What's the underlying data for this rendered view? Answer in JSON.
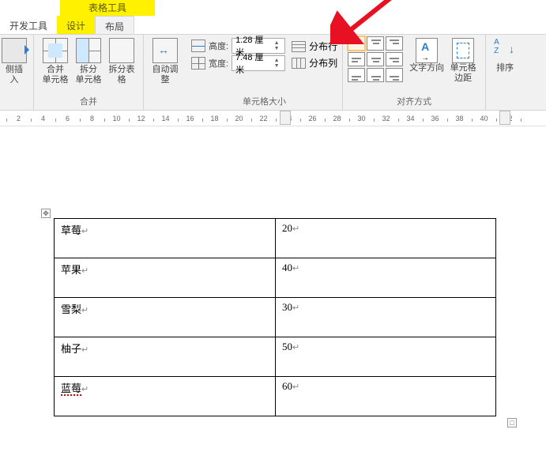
{
  "context_tab_title": "表格工具",
  "tabs": {
    "dev": "开发工具",
    "design": "设计",
    "layout": "布局"
  },
  "ribbon": {
    "insert_side": "侧插入",
    "merge_cells": "合并\n单元格",
    "split_cells": "拆分\n单元格",
    "split_table": "拆分表格",
    "group_merge": "合并",
    "autofit": "自动调整",
    "height_label": "高度:",
    "height_value": "1.28 厘米",
    "width_label": "宽度:",
    "width_value": "7.48 厘米",
    "dist_rows": "分布行",
    "dist_cols": "分布列",
    "group_cellsize": "单元格大小",
    "text_direction": "文字方向",
    "cell_margins": "单元格\n边距",
    "group_alignment": "对齐方式",
    "sort": "排序"
  },
  "ruler_numbers": [
    2,
    4,
    6,
    8,
    10,
    12,
    14,
    16,
    18,
    20,
    22,
    24,
    26,
    28,
    30,
    32,
    34,
    36,
    38,
    40,
    42
  ],
  "table": {
    "rows": [
      {
        "c1": "草莓",
        "c2": "20",
        "err": false
      },
      {
        "c1": "苹果",
        "c2": "40",
        "err": false
      },
      {
        "c1": "雪梨",
        "c2": "30",
        "err": false
      },
      {
        "c1": "柚子",
        "c2": "50",
        "err": false
      },
      {
        "c1": "蓝莓",
        "c2": "60",
        "err": true
      }
    ]
  }
}
